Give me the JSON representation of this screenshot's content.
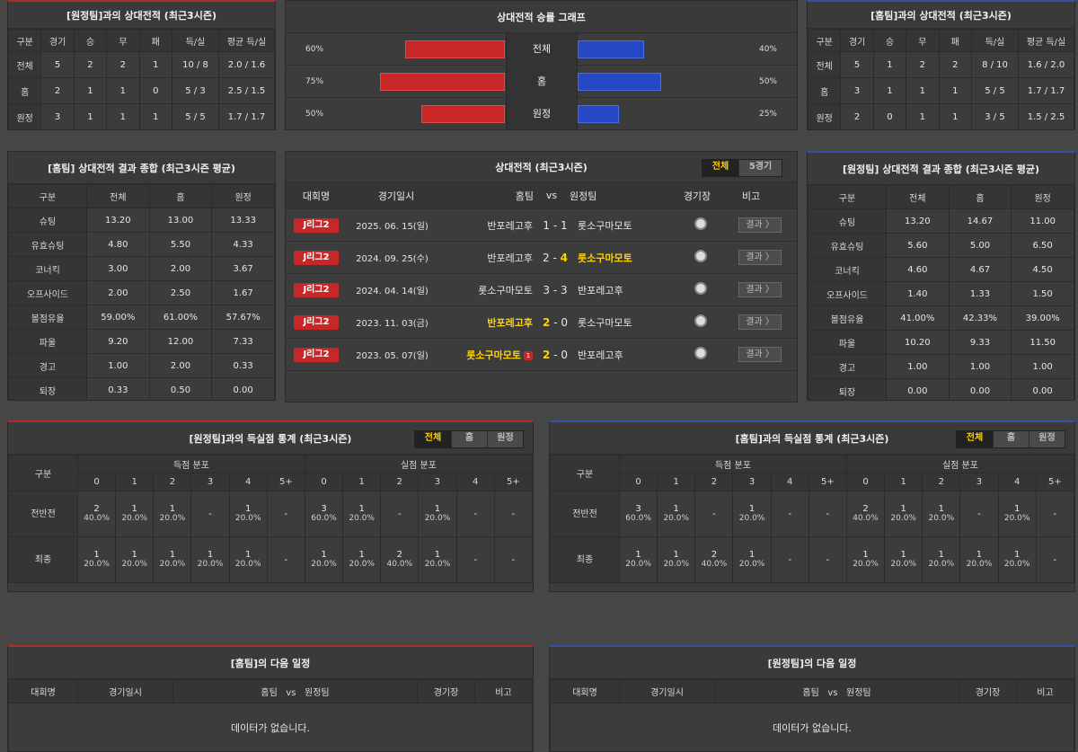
{
  "away_h2h": {
    "title": "[원정팀]과의 상대전적 (최근3시즌)",
    "headers": [
      "구분",
      "경기",
      "승",
      "무",
      "패",
      "득/실",
      "평균 득/실"
    ],
    "rows": [
      [
        "전체",
        "5",
        "2",
        "2",
        "1",
        "10 / 8",
        "2.0 / 1.6"
      ],
      [
        "홈",
        "2",
        "1",
        "1",
        "0",
        "5 / 3",
        "2.5 / 1.5"
      ],
      [
        "원정",
        "3",
        "1",
        "1",
        "1",
        "5 / 5",
        "1.7 / 1.7"
      ]
    ]
  },
  "home_h2h": {
    "title": "[홈팀]과의 상대전적 (최근3시즌)",
    "headers": [
      "구분",
      "경기",
      "승",
      "무",
      "패",
      "득/실",
      "평균 득/실"
    ],
    "rows": [
      [
        "전체",
        "5",
        "1",
        "2",
        "2",
        "8 / 10",
        "1.6 / 2.0"
      ],
      [
        "홈",
        "3",
        "1",
        "1",
        "1",
        "5 / 5",
        "1.7 / 1.7"
      ],
      [
        "원정",
        "2",
        "0",
        "1",
        "1",
        "3 / 5",
        "1.5 / 2.5"
      ]
    ]
  },
  "graph": {
    "title": "상대전적 승률 그래프",
    "rows": [
      {
        "label": "전체",
        "left": "60%",
        "right": "40%",
        "left_val": 0.6,
        "right_val": 0.4
      },
      {
        "label": "홈",
        "left": "75%",
        "right": "50%",
        "left_val": 0.75,
        "right_val": 0.5
      },
      {
        "label": "원정",
        "left": "50%",
        "right": "25%",
        "left_val": 0.5,
        "right_val": 0.25
      }
    ]
  },
  "home_summary": {
    "title": "[홈팀] 상대전적 결과 종합 (최근3시즌 평균)",
    "headers": [
      "구분",
      "전체",
      "홈",
      "원정"
    ],
    "rows": [
      [
        "슈팅",
        "13.20",
        "13.00",
        "13.33"
      ],
      [
        "유효슈팅",
        "4.80",
        "5.50",
        "4.33"
      ],
      [
        "코너킥",
        "3.00",
        "2.00",
        "3.67"
      ],
      [
        "오프사이드",
        "2.00",
        "2.50",
        "1.67"
      ],
      [
        "볼점유율",
        "59.00%",
        "61.00%",
        "57.67%"
      ],
      [
        "파울",
        "9.20",
        "12.00",
        "7.33"
      ],
      [
        "경고",
        "1.00",
        "2.00",
        "0.33"
      ],
      [
        "퇴장",
        "0.33",
        "0.50",
        "0.00"
      ]
    ]
  },
  "away_summary": {
    "title": "[원정팀] 상대전적 결과 종합 (최근3시즌 평균)",
    "headers": [
      "구분",
      "전체",
      "홈",
      "원정"
    ],
    "rows": [
      [
        "슈팅",
        "13.20",
        "14.67",
        "11.00"
      ],
      [
        "유효슈팅",
        "5.60",
        "5.00",
        "6.50"
      ],
      [
        "코너킥",
        "4.60",
        "4.67",
        "4.50"
      ],
      [
        "오프사이드",
        "1.40",
        "1.33",
        "1.50"
      ],
      [
        "볼점유율",
        "41.00%",
        "42.33%",
        "39.00%"
      ],
      [
        "파울",
        "10.20",
        "9.33",
        "11.50"
      ],
      [
        "경고",
        "1.00",
        "1.00",
        "1.00"
      ],
      [
        "퇴장",
        "0.00",
        "0.00",
        "0.00"
      ]
    ]
  },
  "matches": {
    "title": "상대전적 (최근3시즌)",
    "toggle": [
      "전체",
      "5경기"
    ],
    "headers": {
      "league": "대회명",
      "date": "경기일시",
      "home": "홈팀",
      "vs": "vs",
      "away": "원정팀",
      "venue": "경기장",
      "note": "비고"
    },
    "result_label": "결과 〉",
    "rows": [
      {
        "league": "J리그2",
        "date": "2025. 06. 15(일)",
        "home": "반포레고후",
        "hs": "1",
        "as": "1",
        "away": "롯소구마모토",
        "win": "none",
        "badge": ""
      },
      {
        "league": "J리그2",
        "date": "2024. 09. 25(수)",
        "home": "반포레고후",
        "hs": "2",
        "as": "4",
        "away": "롯소구마모토",
        "win": "away",
        "badge": ""
      },
      {
        "league": "J리그2",
        "date": "2024. 04. 14(일)",
        "home": "롯소구마모토",
        "hs": "3",
        "as": "3",
        "away": "반포레고후",
        "win": "none",
        "badge": ""
      },
      {
        "league": "J리그2",
        "date": "2023. 11. 03(금)",
        "home": "반포레고후",
        "hs": "2",
        "as": "0",
        "away": "롯소구마모토",
        "win": "home",
        "badge": ""
      },
      {
        "league": "J리그2",
        "date": "2023. 05. 07(일)",
        "home": "롯소구마모토",
        "hs": "2",
        "as": "0",
        "away": "반포레고후",
        "win": "home",
        "badge": "1"
      }
    ]
  },
  "goal_stats_away": {
    "title": "[원정팀]과의 득실점 통계 (최근3시즌)",
    "toggle": [
      "전체",
      "홈",
      "원정"
    ],
    "group_label": "구분",
    "scored_label": "득점 분포",
    "conceded_label": "실점 분포",
    "cols": [
      "0",
      "1",
      "2",
      "3",
      "4",
      "5+"
    ],
    "rows": [
      {
        "label": "전반전",
        "scored": [
          [
            "2",
            "40.0%"
          ],
          [
            "1",
            "20.0%"
          ],
          [
            "1",
            "20.0%"
          ],
          [
            "-",
            ""
          ],
          [
            "1",
            "20.0%"
          ],
          [
            "-",
            ""
          ]
        ],
        "conceded": [
          [
            "3",
            "60.0%"
          ],
          [
            "1",
            "20.0%"
          ],
          [
            "-",
            ""
          ],
          [
            "1",
            "20.0%"
          ],
          [
            "-",
            ""
          ],
          [
            "-",
            ""
          ]
        ]
      },
      {
        "label": "최종",
        "scored": [
          [
            "1",
            "20.0%"
          ],
          [
            "1",
            "20.0%"
          ],
          [
            "1",
            "20.0%"
          ],
          [
            "1",
            "20.0%"
          ],
          [
            "1",
            "20.0%"
          ],
          [
            "-",
            ""
          ]
        ],
        "conceded": [
          [
            "1",
            "20.0%"
          ],
          [
            "1",
            "20.0%"
          ],
          [
            "2",
            "40.0%"
          ],
          [
            "1",
            "20.0%"
          ],
          [
            "-",
            ""
          ],
          [
            "-",
            ""
          ]
        ]
      }
    ]
  },
  "goal_stats_home": {
    "title": "[홈팀]과의 득실점 통계 (최근3시즌)",
    "toggle": [
      "전체",
      "홈",
      "원정"
    ],
    "group_label": "구분",
    "scored_label": "득점 분포",
    "conceded_label": "실점 분포",
    "cols": [
      "0",
      "1",
      "2",
      "3",
      "4",
      "5+"
    ],
    "rows": [
      {
        "label": "전반전",
        "scored": [
          [
            "3",
            "60.0%"
          ],
          [
            "1",
            "20.0%"
          ],
          [
            "-",
            ""
          ],
          [
            "1",
            "20.0%"
          ],
          [
            "-",
            ""
          ],
          [
            "-",
            ""
          ]
        ],
        "conceded": [
          [
            "2",
            "40.0%"
          ],
          [
            "1",
            "20.0%"
          ],
          [
            "1",
            "20.0%"
          ],
          [
            "-",
            ""
          ],
          [
            "1",
            "20.0%"
          ],
          [
            "-",
            ""
          ]
        ]
      },
      {
        "label": "최종",
        "scored": [
          [
            "1",
            "20.0%"
          ],
          [
            "1",
            "20.0%"
          ],
          [
            "2",
            "40.0%"
          ],
          [
            "1",
            "20.0%"
          ],
          [
            "-",
            ""
          ],
          [
            "-",
            ""
          ]
        ],
        "conceded": [
          [
            "1",
            "20.0%"
          ],
          [
            "1",
            "20.0%"
          ],
          [
            "1",
            "20.0%"
          ],
          [
            "1",
            "20.0%"
          ],
          [
            "1",
            "20.0%"
          ],
          [
            "-",
            ""
          ]
        ]
      }
    ]
  },
  "next_home": {
    "title": "[홈팀]의 다음 일정",
    "headers": {
      "league": "대회명",
      "date": "경기일시",
      "home": "홈팀",
      "vs": "vs",
      "away": "원정팀",
      "venue": "경기장",
      "note": "비고"
    },
    "empty": "데이터가 없습니다."
  },
  "next_away": {
    "title": "[원정팀]의 다음 일정",
    "headers": {
      "league": "대회명",
      "date": "경기일시",
      "home": "홈팀",
      "vs": "vs",
      "away": "원정팀",
      "venue": "경기장",
      "note": "비고"
    },
    "empty": "데이터가 없습니다."
  }
}
